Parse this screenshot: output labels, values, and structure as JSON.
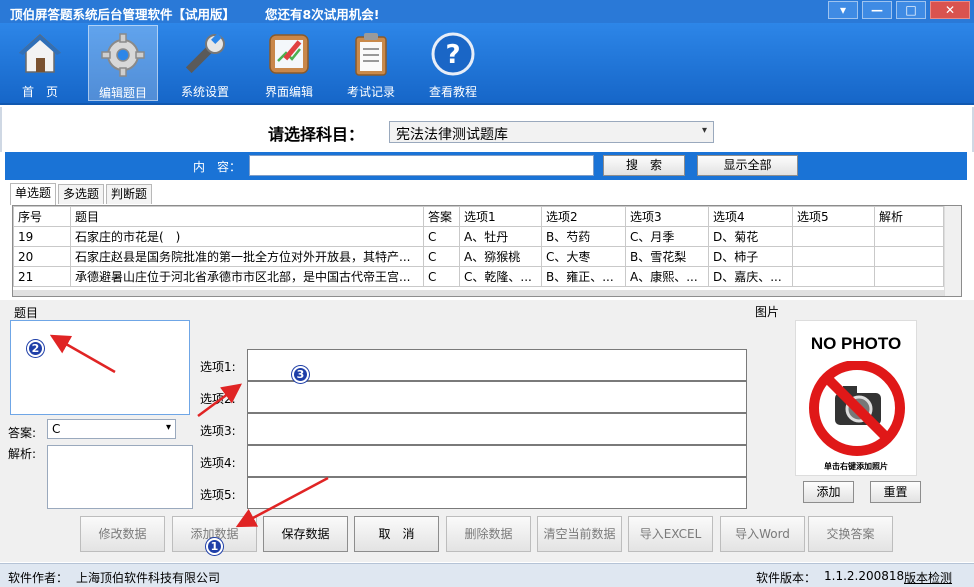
{
  "window": {
    "title": "顶伯屏答题系统后台管理软件【试用版】",
    "trial_notice": "您还有8次试用机会!",
    "controls": [
      "▾",
      "—",
      "□",
      "✕"
    ]
  },
  "toolbar": {
    "items": [
      {
        "label": "首　页",
        "icon": "home-icon"
      },
      {
        "label": "编辑题目",
        "icon": "gear-icon",
        "active": true
      },
      {
        "label": "系统设置",
        "icon": "wrench-icon"
      },
      {
        "label": "界面编辑",
        "icon": "edit-picture-icon"
      },
      {
        "label": "考试记录",
        "icon": "clipboard-icon"
      },
      {
        "label": "查看教程",
        "icon": "help-icon"
      }
    ]
  },
  "subject": {
    "label": "请选择科目：",
    "selected": "宪法法律测试题库"
  },
  "search": {
    "label": "内　容：",
    "value": "",
    "search_button": "搜　索",
    "show_all_button": "显示全部"
  },
  "tabs": [
    "单选题",
    "多选题",
    "判断题"
  ],
  "grid": {
    "columns": [
      "序号",
      "题目",
      "答案",
      "选项1",
      "选项2",
      "选项3",
      "选项4",
      "选项5",
      "解析"
    ],
    "rows": [
      [
        "19",
        "石家庄的市花是(　)",
        "C",
        "A、牡丹",
        "B、芍药",
        "C、月季",
        "D、菊花",
        "",
        ""
      ],
      [
        "20",
        "石家庄赵县是国务院批准的第一批全方位对外开放县，其特产...",
        "C",
        "A、猕猴桃",
        "C、大枣",
        "B、雪花梨",
        "D、柿子",
        "",
        ""
      ],
      [
        "21",
        "承德避暑山庄位于河北省承德市市区北部，是中国古代帝王宫...",
        "C",
        "C、乾隆、...",
        "B、雍正、...",
        "A、康熙、...",
        "D、嘉庆、...",
        "",
        ""
      ]
    ]
  },
  "editor": {
    "question_label": "题目",
    "answer_label": "答案:",
    "answer_value": "C",
    "analysis_label": "解析:",
    "option_labels": [
      "选项1:",
      "选项2:",
      "选项3:",
      "选项4:",
      "选项5:"
    ],
    "option_values": [
      "",
      "",
      "",
      "",
      ""
    ]
  },
  "photo": {
    "label": "图片",
    "placeholder_title": "NO PHOTO",
    "hint": "单击右键添加照片",
    "add_button": "添加",
    "reset_button": "重置"
  },
  "actions": [
    "修改数据",
    "添加数据",
    "保存数据",
    "取　消",
    "删除数据",
    "清空当前数据",
    "导入EXCEL",
    "导入Word",
    "交换答案"
  ],
  "status": {
    "author_label": "软件作者：",
    "author": "上海顶伯软件科技有限公司",
    "version_label": "软件版本：",
    "version": "1.1.2.200818",
    "check_version": "版本检测"
  },
  "annotations": [
    "1",
    "2",
    "3"
  ],
  "colors": {
    "title_bar": "#2a79d7",
    "toolbar": "#1e6fd0",
    "search_bar": "#1a73d6",
    "annotation_arrow": "#e02424",
    "badge": "#1f3fa8"
  }
}
